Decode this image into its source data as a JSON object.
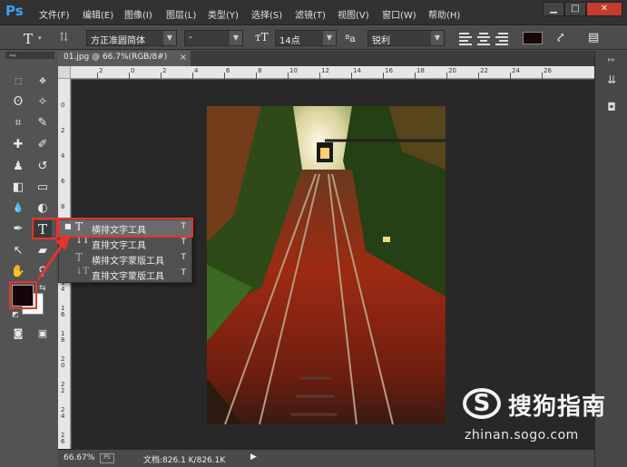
{
  "app": {
    "logo": "Ps"
  },
  "menubar": {
    "items": [
      "文件(F)",
      "编辑(E)",
      "图像(I)",
      "图层(L)",
      "类型(Y)",
      "选择(S)",
      "滤镜(T)",
      "视图(V)",
      "窗口(W)",
      "帮助(H)"
    ],
    "window_controls": [
      "▁",
      "□",
      "✕"
    ]
  },
  "options_bar": {
    "font_family": "方正准圆简体",
    "font_style": "-",
    "font_size": "14点",
    "aa_label": "ªa",
    "antialias": "锐利",
    "text_color": "#1a0508"
  },
  "document": {
    "tab_title": "01.jpg @ 66.7%(RGB/8#)",
    "tab_close": "×",
    "ruler_top_labels": [
      "4",
      "2",
      "0",
      "2",
      "4",
      "6",
      "8",
      "10",
      "12",
      "14",
      "16",
      "18",
      "20",
      "22",
      "24",
      "26"
    ],
    "ruler_left_labels": [
      "0",
      "2",
      "4",
      "6",
      "8",
      "1 0",
      "1 2",
      "1 4",
      "1 6",
      "1 8",
      "2 0",
      "2 2",
      "2 4",
      "2 6"
    ]
  },
  "status": {
    "zoom": "66.67%",
    "doc_info": "文档:826.1 K/826.1K",
    "arrow": "▶"
  },
  "tools": {
    "marquee": "⬚",
    "move": "✥",
    "lasso": "ʘ",
    "magic_wand": "✧",
    "crop": "⌗",
    "eyedropper": "✎",
    "healing": "✚",
    "brush": "✐",
    "stamp": "♟",
    "history_brush": "↺",
    "eraser": "◧",
    "gradient": "▭",
    "blur": "💧",
    "dodge": "◐",
    "pen": "✒",
    "type": "T",
    "path_select": "↖",
    "shape": "▰",
    "hand": "✋",
    "zoom": "⚲",
    "quick_mask": "◙",
    "screen_mode": "▣"
  },
  "flyout": {
    "items": [
      {
        "label": "横排文字工具",
        "shortcut": "T",
        "icon": "T"
      },
      {
        "label": "直排文字工具",
        "shortcut": "T",
        "icon": "↓T"
      },
      {
        "label": "横排文字蒙版工具",
        "shortcut": "T",
        "icon": "T"
      },
      {
        "label": "直排文字蒙版工具",
        "shortcut": "T",
        "icon": "↓T"
      }
    ]
  },
  "swatches": {
    "foreground": "#140308",
    "background": "#ffffff"
  },
  "watermark": {
    "logo": "S",
    "title": "搜狗指南",
    "url": "zhinan.sogo.com"
  },
  "colors": {
    "accent": "#33a6ff",
    "callout": "#e8322f"
  }
}
